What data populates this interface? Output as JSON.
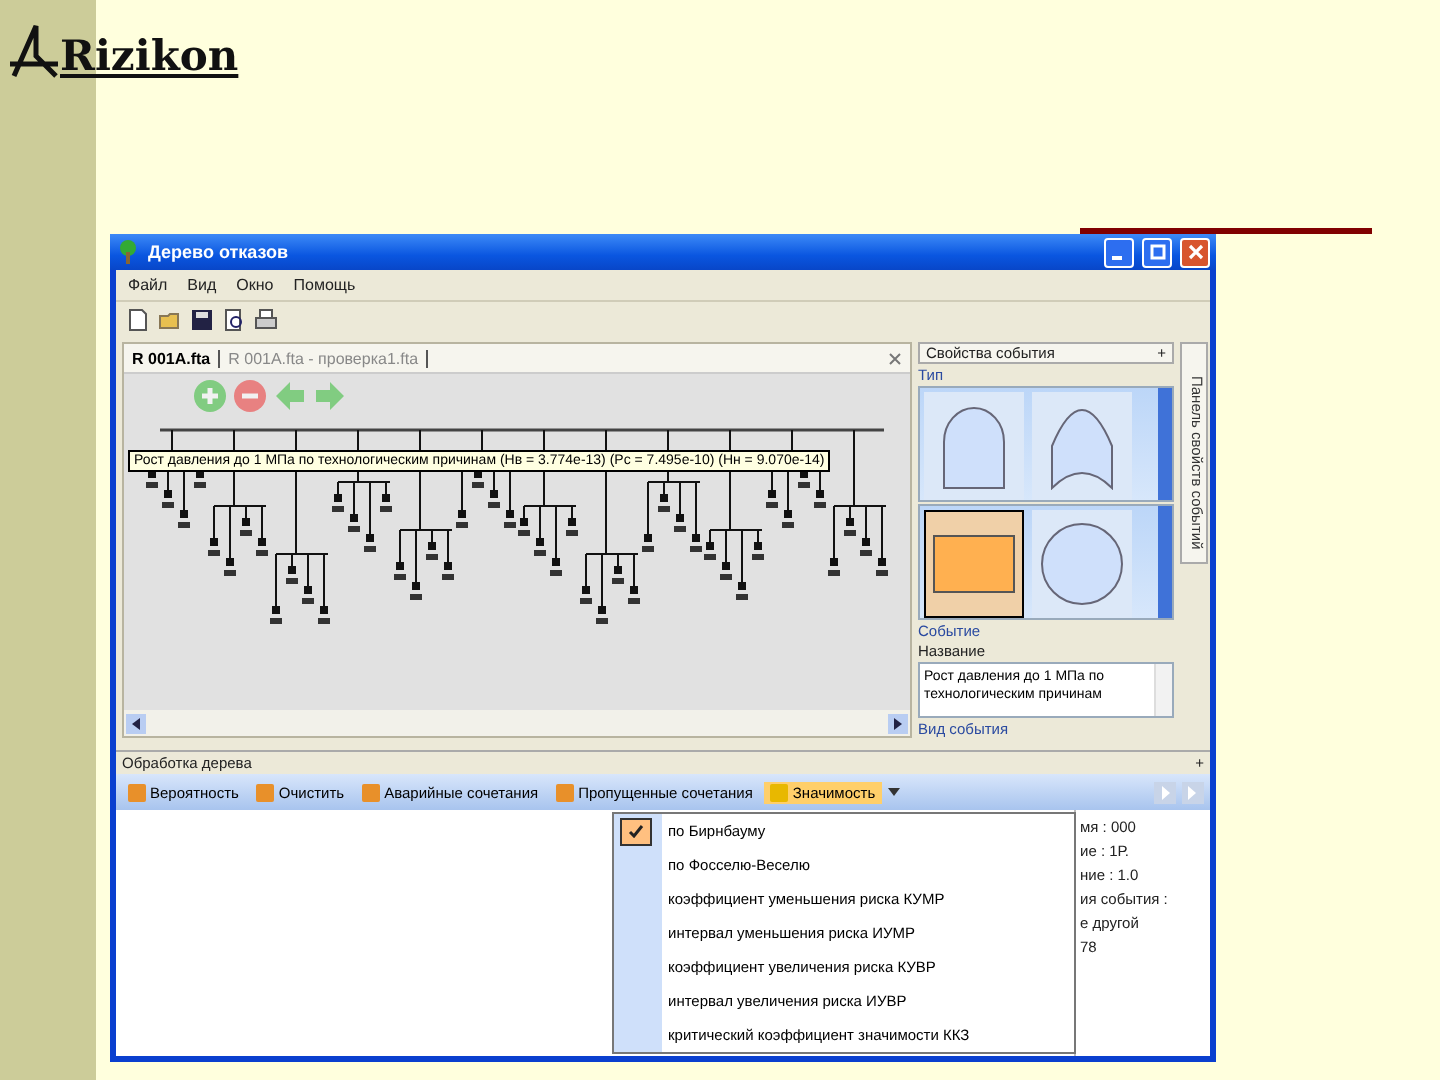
{
  "slide": {
    "logo": "Rizikon"
  },
  "window": {
    "title": "Дерево отказов"
  },
  "menu": [
    "Файл",
    "Вид",
    "Окно",
    "Помощь"
  ],
  "doc_tabs": [
    {
      "label": "R 001A.fta",
      "selected": true
    },
    {
      "label": "R 001A.fta - проверка1.fta",
      "selected": false
    }
  ],
  "diagram": {
    "tooltip": "Рост давления до 1 МПа по технологическим причинам (Нв = 3.774e-13) (Рс = 7.495e-10) (Нн = 9.070e-14)"
  },
  "properties": {
    "title": "Свойства события",
    "pin": "+",
    "type_group": "Тип",
    "shapes": [
      {
        "kind": "and",
        "selected": false
      },
      {
        "kind": "or",
        "selected": false
      },
      {
        "kind": "basic",
        "selected": true
      },
      {
        "kind": "circle",
        "selected": false
      }
    ],
    "event_group": "Событие",
    "name_label": "Название",
    "name_value": "Рост давления до 1 МПа по технологическим причинам",
    "event_kind_label": "Вид события"
  },
  "side_tab": "Панель свойств событий",
  "bottom": {
    "title": "Обработка дерева",
    "pin": "+",
    "tools": [
      {
        "label": "Вероятность",
        "active": false
      },
      {
        "label": "Очистить",
        "active": false
      },
      {
        "label": "Аварийные сочетания",
        "active": false
      },
      {
        "label": "Пропущенные сочетания",
        "active": false
      },
      {
        "label": "Значимость",
        "active": true
      }
    ],
    "details": [
      "мя : 000",
      "ие : 1Р.",
      "ние : 1.0",
      "ия события :",
      "е другой",
      "78"
    ],
    "menu": [
      {
        "label": "по Бирнбауму",
        "checked": true
      },
      {
        "label": "по Фосселю-Веселю",
        "checked": false
      },
      {
        "label": "коэффициент уменьшения риска КУМР",
        "checked": false
      },
      {
        "label": "интервал уменьшения риска ИУМР",
        "checked": false
      },
      {
        "label": "коэффициент увеличения риска КУВР",
        "checked": false
      },
      {
        "label": "интервал увеличения риска ИУВР",
        "checked": false
      },
      {
        "label": "критический коэффициент значимости ККЗ",
        "checked": false
      }
    ]
  }
}
